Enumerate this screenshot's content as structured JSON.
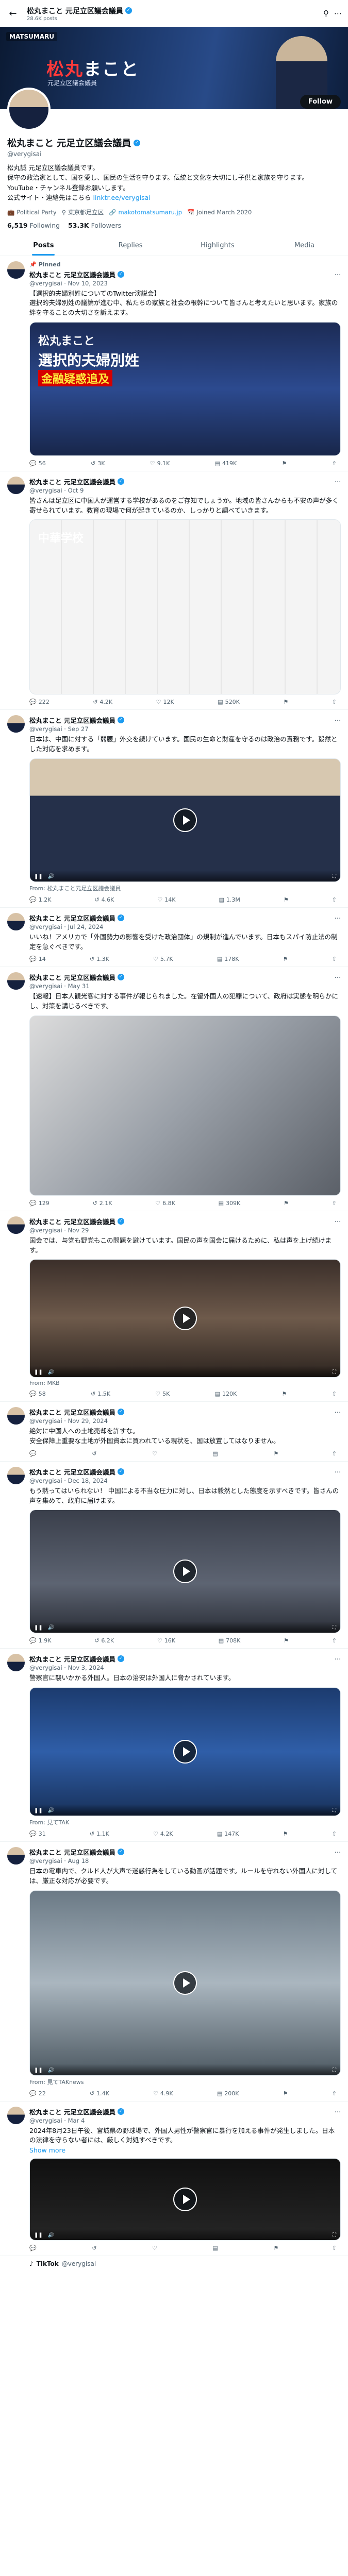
{
  "header": {
    "title": "松丸まこと 元足立区議会議員",
    "posts_count": "28.6K posts",
    "search_icon": "search-icon",
    "more_icon": "more-icon"
  },
  "banner": {
    "logo": "MATSUMARU",
    "title_a": "松丸",
    "title_b": "まこと",
    "subtitle": "元足立区議会議員"
  },
  "profile": {
    "name": "松丸まこと 元足立区議会議員",
    "handle": "@verygisai",
    "follow_label": "Follow",
    "bio": "松丸誠 元足立区議会議員です。\n保守の政治家として、国を愛し、国民の生活を守ります。伝統と文化を大切にし子供と家族を守ります。YouTube・チャンネル登録お願いします。\n公式サイト・連絡先はこちら",
    "bio_link": "linktr.ee/verygisai",
    "category": "Political Party",
    "location": "東京都足立区",
    "website": "makotomatsumaru.jp",
    "joined": "Joined March 2020",
    "following_count": "6,519",
    "following_label": "Following",
    "followers_count": "53.3K",
    "followers_label": "Followers"
  },
  "tabs": [
    "Posts",
    "Replies",
    "Highlights",
    "Media"
  ],
  "tweets": [
    {
      "pinned": "Pinned",
      "name": "松丸まこと 元足立区議会議員",
      "handle": "@verygisai · Nov 10, 2023",
      "text": "【選択的夫婦別姓についてのTwitter演説会】\n選択的夫婦別姓の議論が進む中、私たちの家族と社会の根幹について皆さんと考えたいと思います。家族の絆を守ることの大切さを訴えます。",
      "show_more": "",
      "media_caption_a": "松丸まこと",
      "media_caption_b": "選択的夫婦別姓",
      "media_caption_c": "金融疑惑追及",
      "from": "",
      "replies": "56",
      "reposts": "3K",
      "likes": "9.1K",
      "views": "419K"
    },
    {
      "pinned": "",
      "name": "松丸まこと 元足立区議会議員",
      "handle": "@verygisai · Oct 9",
      "text": "皆さんは足立区に中国人が運営する学校があるのをご存知でしょうか。地域の皆さんからも不安の声が多く寄せられています。教育の現場で何が起きているのか、しっかりと調べていきます。",
      "show_more": "",
      "media_caption_a": "中華学校",
      "media_caption_b": "",
      "media_caption_c": "",
      "from": "",
      "replies": "222",
      "reposts": "4.2K",
      "likes": "12K",
      "views": "520K"
    },
    {
      "pinned": "",
      "name": "松丸まこと 元足立区議会議員",
      "handle": "@verygisai · Sep 27",
      "text": "日本は、中国に対する「弱腰」外交を続けています。国民の生命と財産を守るのは政治の責務です。毅然とした対応を求めます。",
      "show_more": "",
      "media_caption_a": "",
      "media_caption_b": "",
      "media_caption_c": "",
      "from": "From: 松丸まこと元足立区議会議員",
      "replies": "1.2K",
      "reposts": "4.6K",
      "likes": "14K",
      "views": "1.3M"
    },
    {
      "pinned": "",
      "name": "松丸まこと 元足立区議会議員",
      "handle": "@verygisai · Jul 24, 2024",
      "text": "いいね！アメリカで「外国勢力の影響を受けた政治団体」の規制が進んでいます。日本もスパイ防止法の制定を急ぐべきです。",
      "show_more": "",
      "media_caption_a": "",
      "media_caption_b": "",
      "media_caption_c": "",
      "from": "",
      "replies": "14",
      "reposts": "1.3K",
      "likes": "5.7K",
      "views": "178K"
    },
    {
      "pinned": "",
      "name": "松丸まこと 元足立区議会議員",
      "handle": "@verygisai · May 31",
      "text": "【速報】日本人観光客に対する事件が報じられました。在留外国人の犯罪について、政府は実態を明らかにし、対策を講じるべきです。",
      "show_more": "",
      "media_caption_a": "",
      "media_caption_b": "",
      "media_caption_c": "",
      "from": "",
      "replies": "129",
      "reposts": "2.1K",
      "likes": "6.8K",
      "views": "309K"
    },
    {
      "pinned": "",
      "name": "松丸まこと 元足立区議会議員",
      "handle": "@verygisai · Nov 29",
      "text": "国会では、与党も野党もこの問題を避けています。国民の声を国会に届けるために、私は声を上げ続けます。",
      "show_more": "",
      "media_caption_a": "",
      "media_caption_b": "",
      "media_caption_c": "",
      "from": "From: MKB",
      "replies": "58",
      "reposts": "1.5K",
      "likes": "5K",
      "views": "120K"
    },
    {
      "pinned": "",
      "name": "松丸まこと 元足立区議会議員",
      "handle": "@verygisai · Nov 29, 2024",
      "text": "絶対に中国人への土地売却を許すな。\n安全保障上重要な土地が外国資本に買われている現状を、国は放置してはなりません。",
      "show_more": "",
      "media_caption_a": "",
      "media_caption_b": "",
      "media_caption_c": "",
      "from": "",
      "replies": "",
      "reposts": "",
      "likes": "",
      "views": ""
    },
    {
      "pinned": "",
      "name": "松丸まこと 元足立区議会議員",
      "handle": "@verygisai · Dec 18, 2024",
      "text": "もう黙ってはいられない！ 中国による不当な圧力に対し、日本は毅然とした態度を示すべきです。皆さんの声を集めて、政府に届けます。",
      "show_more": "",
      "media_caption_a": "",
      "media_caption_b": "",
      "media_caption_c": "",
      "from": "",
      "replies": "1.9K",
      "reposts": "6.2K",
      "likes": "16K",
      "views": "708K"
    },
    {
      "pinned": "",
      "name": "松丸まこと 元足立区議会議員",
      "handle": "@verygisai · Nov 3, 2024",
      "text": "警察官に襲いかかる外国人。日本の治安は外国人に脅かされています。",
      "show_more": "",
      "media_caption_a": "",
      "media_caption_b": "",
      "media_caption_c": "",
      "from": "From: 見てTAK",
      "replies": "31",
      "reposts": "1.1K",
      "likes": "4.2K",
      "views": "147K"
    },
    {
      "pinned": "",
      "name": "松丸まこと 元足立区議会議員",
      "handle": "@verygisai · Aug 18",
      "text": "日本の電車内で、クルド人が大声で迷惑行為をしている動画が話題です。ルールを守れない外国人に対しては、厳正な対応が必要です。",
      "show_more": "",
      "media_caption_a": "",
      "media_caption_b": "",
      "media_caption_c": "",
      "from": "From: 見てTAKnews",
      "replies": "22",
      "reposts": "1.4K",
      "likes": "4.9K",
      "views": "200K"
    },
    {
      "pinned": "",
      "name": "松丸まこと 元足立区議会議員",
      "handle": "@verygisai · Mar 4",
      "text": "2024年8月23日午後、宮城県の野球場で、外国人男性が警察官に暴行を加える事件が発生しました。日本の法律を守らない者には、厳しく対処すべきです。",
      "show_more": "Show more",
      "media_caption_a": "",
      "media_caption_b": "",
      "media_caption_c": "",
      "from": "",
      "replies": "",
      "reposts": "",
      "likes": "",
      "views": ""
    }
  ],
  "tiktok": {
    "brand": "TikTok",
    "handle": "@verygisai"
  }
}
